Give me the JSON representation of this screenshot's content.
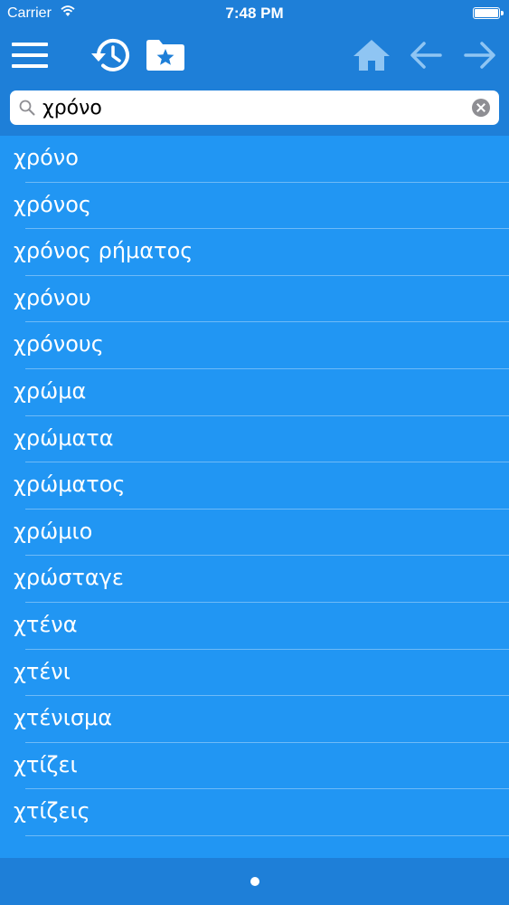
{
  "status": {
    "carrier": "Carrier",
    "time": "7:48 PM"
  },
  "toolbar": {
    "icons": [
      "menu-icon",
      "history-icon",
      "favorites-folder-icon",
      "home-icon",
      "back-arrow-icon",
      "forward-arrow-icon"
    ],
    "accent_color": "#1e7fd8",
    "inactive_icon_color": "#8fc5f3"
  },
  "search": {
    "value": "χρόνο"
  },
  "results": [
    {
      "label": "χρόνο"
    },
    {
      "label": "χρόνος"
    },
    {
      "label": "χρόνος ρήματος"
    },
    {
      "label": "χρόνου"
    },
    {
      "label": "χρόνους"
    },
    {
      "label": "χρώμα"
    },
    {
      "label": "χρώματα"
    },
    {
      "label": "χρώματος"
    },
    {
      "label": "χρώμιο"
    },
    {
      "label": "χρώσταγε"
    },
    {
      "label": "χτένα"
    },
    {
      "label": "χτένι"
    },
    {
      "label": "χτένισμα"
    },
    {
      "label": "χτίζει"
    },
    {
      "label": "χτίζεις"
    }
  ],
  "colors": {
    "list_background": "#2196f3",
    "bar_background": "#1e7fd8"
  }
}
